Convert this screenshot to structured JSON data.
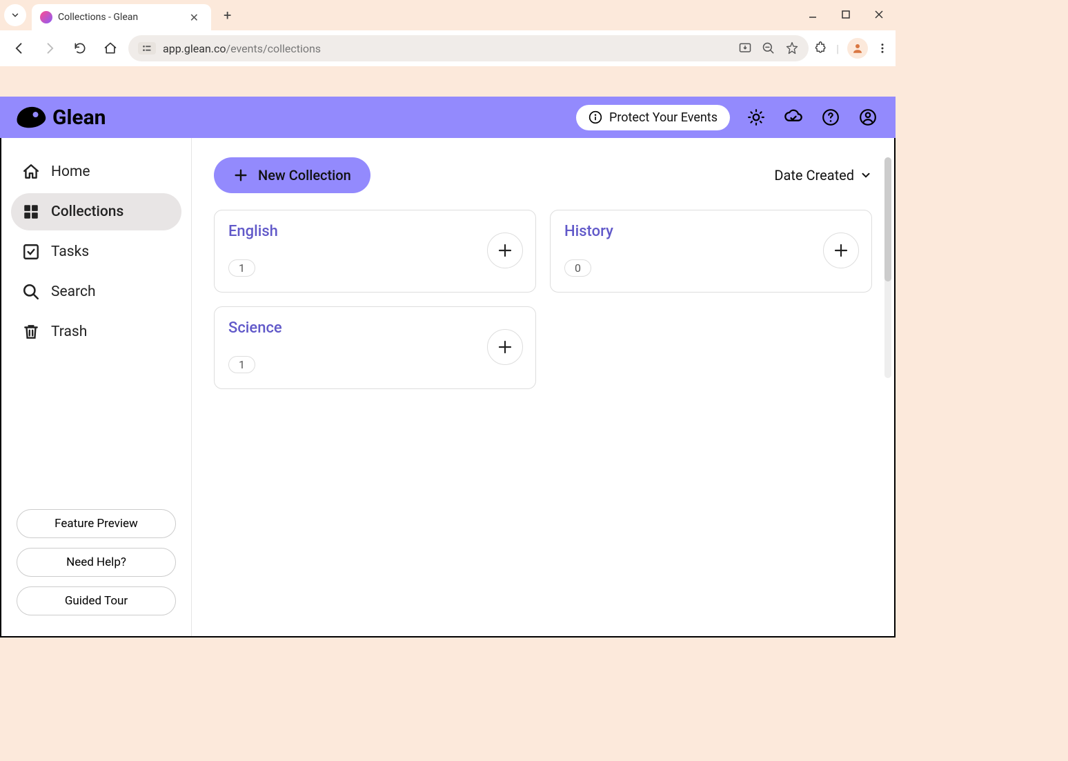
{
  "browser": {
    "tab_title": "Collections - Glean",
    "url_host": "app.glean.co",
    "url_path": "/events/collections"
  },
  "app": {
    "logo_text": "Glean",
    "protect_label": "Protect Your Events"
  },
  "sidebar": {
    "items": [
      {
        "label": "Home"
      },
      {
        "label": "Collections"
      },
      {
        "label": "Tasks"
      },
      {
        "label": "Search"
      },
      {
        "label": "Trash"
      }
    ],
    "bottom": [
      {
        "label": "Feature Preview"
      },
      {
        "label": "Need Help?"
      },
      {
        "label": "Guided Tour"
      }
    ]
  },
  "main": {
    "new_collection_label": "New Collection",
    "sort_label": "Date Created",
    "collections": [
      {
        "title": "English",
        "count": "1"
      },
      {
        "title": "History",
        "count": "0"
      },
      {
        "title": "Science",
        "count": "1"
      }
    ]
  }
}
